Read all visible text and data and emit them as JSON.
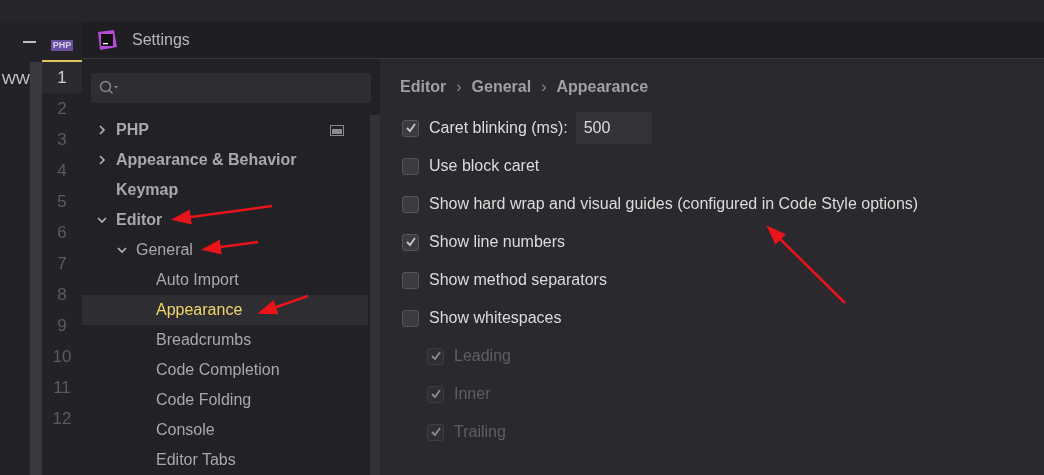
{
  "editor": {
    "text": "WW",
    "file_tab_icon": "PHP",
    "lines": [
      {
        "number": "1",
        "current": true
      },
      {
        "number": "2",
        "current": false
      },
      {
        "number": "3",
        "current": false
      },
      {
        "number": "4",
        "current": false
      },
      {
        "number": "5",
        "current": false
      },
      {
        "number": "6",
        "current": false
      },
      {
        "number": "7",
        "current": false
      },
      {
        "number": "8",
        "current": false
      },
      {
        "number": "9",
        "current": false
      },
      {
        "number": "10",
        "current": false
      },
      {
        "number": "11",
        "current": false
      },
      {
        "number": "12",
        "current": false
      }
    ]
  },
  "window": {
    "title": "Settings"
  },
  "sidebar": {
    "items": [
      {
        "label": "PHP",
        "expanded": false,
        "selected": false,
        "project_icon": true
      },
      {
        "label": "Appearance & Behavior",
        "expanded": false,
        "selected": false
      },
      {
        "label": "Keymap",
        "selected": false
      },
      {
        "label": "Editor",
        "expanded": true,
        "selected": false,
        "children": [
          {
            "label": "General",
            "expanded": true,
            "selected": false,
            "children": [
              {
                "label": "Auto Import",
                "selected": false
              },
              {
                "label": "Appearance",
                "selected": true
              },
              {
                "label": "Breadcrumbs",
                "selected": false
              },
              {
                "label": "Code Completion",
                "selected": false
              },
              {
                "label": "Code Folding",
                "selected": false
              },
              {
                "label": "Console",
                "selected": false
              },
              {
                "label": "Editor Tabs",
                "selected": false
              }
            ]
          }
        ]
      }
    ]
  },
  "breadcrumb": {
    "separator": "›",
    "items": [
      "Editor",
      "General",
      "Appearance"
    ]
  },
  "options": [
    {
      "label": "Caret blinking (ms):",
      "checked": true,
      "disabled": false,
      "value": "500"
    },
    {
      "label": "Use block caret",
      "checked": false,
      "disabled": false
    },
    {
      "label": "Show hard wrap and visual guides (configured in Code Style options)",
      "checked": false,
      "disabled": false
    },
    {
      "label": "Show line numbers",
      "checked": true,
      "disabled": false
    },
    {
      "label": "Show method separators",
      "checked": false,
      "disabled": false
    },
    {
      "label": "Show whitespaces",
      "checked": false,
      "disabled": false,
      "children": [
        {
          "label": "Leading",
          "checked": true,
          "disabled": true
        },
        {
          "label": "Inner",
          "checked": true,
          "disabled": true
        },
        {
          "label": "Trailing",
          "checked": true,
          "disabled": true
        }
      ]
    }
  ]
}
